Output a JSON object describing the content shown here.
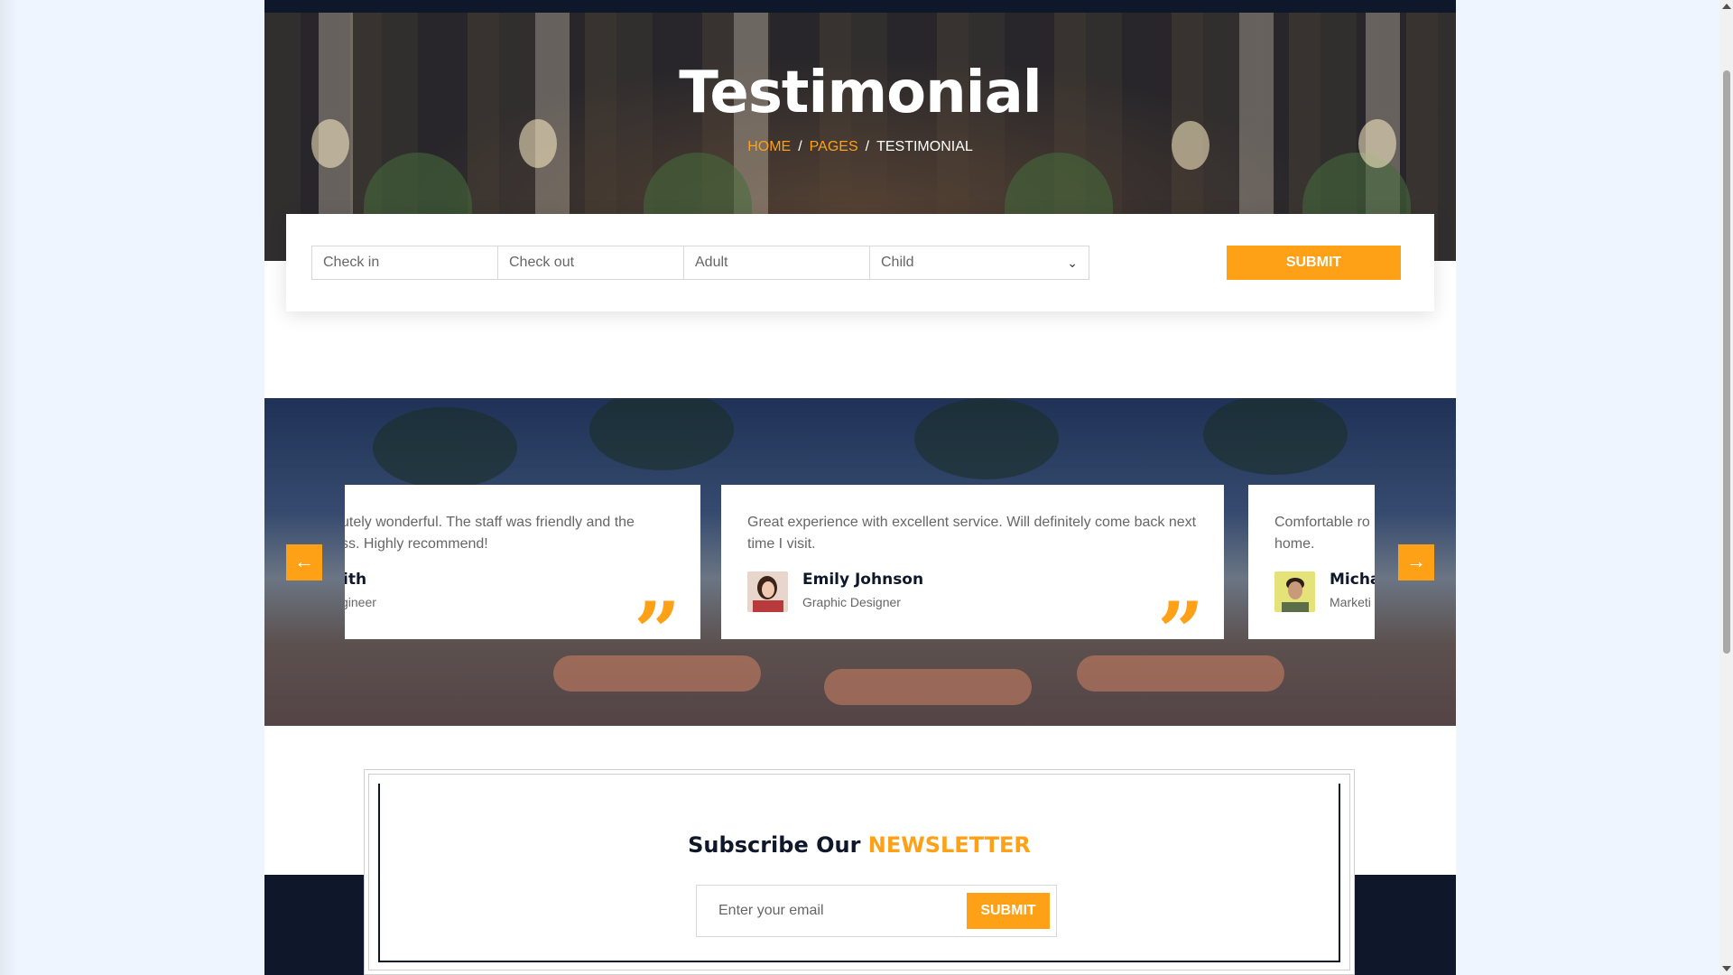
{
  "hero": {
    "title": "Testimonial",
    "breadcrumb": {
      "home": "HOME",
      "pages": "PAGES",
      "current": "TESTIMONIAL",
      "separator": "/"
    }
  },
  "booking": {
    "check_in_placeholder": "Check in",
    "check_out_placeholder": "Check out",
    "adult_label": "Adult",
    "child_label": "Child",
    "submit_label": "SUBMIT"
  },
  "testimonials": {
    "prev_icon": "arrow-left-icon",
    "next_icon": "arrow-right-icon",
    "items": [
      {
        "text_line1": "utely wonderful. The staff was friendly and the",
        "text_line2": "ss. Highly recommend!",
        "name": "ith",
        "role": "gineer"
      },
      {
        "text_line1": "Great experience with excellent service. Will definitely come back next",
        "text_line2": "time I visit.",
        "name": "Emily Johnson",
        "role": "Graphic Designer"
      },
      {
        "text_line1": "Comfortable ro",
        "text_line2": "home.",
        "name": "Micha",
        "role": "Marketi"
      }
    ],
    "quote_glyph": "”"
  },
  "newsletter": {
    "title_prefix": "Subscribe Our",
    "title_accent": "NEWSLETTER",
    "email_placeholder": "Enter your email",
    "submit_label": "SUBMIT"
  },
  "colors": {
    "accent": "#fea116",
    "dark": "#0f172b"
  }
}
